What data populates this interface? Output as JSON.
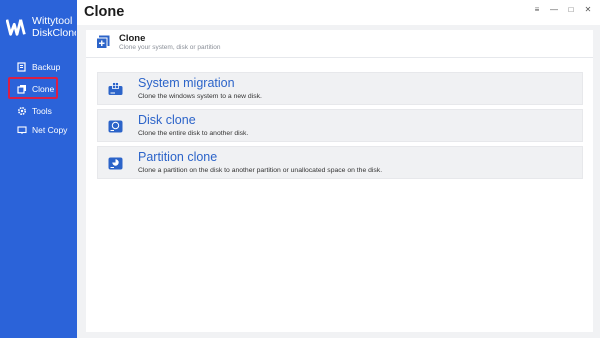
{
  "app": {
    "name_line1": "Wittytool",
    "name_line2": "DiskClone"
  },
  "sidebar": {
    "items": [
      {
        "label": "Backup",
        "icon": "backup-icon"
      },
      {
        "label": "Clone",
        "icon": "clone-icon",
        "active": true
      },
      {
        "label": "Tools",
        "icon": "gear-icon"
      },
      {
        "label": "Net Copy",
        "icon": "net-copy-icon"
      }
    ]
  },
  "titlebar": {
    "title": "Clone",
    "controls": [
      "menu-icon",
      "minimize-icon",
      "maximize-icon",
      "close-icon"
    ]
  },
  "section": {
    "title": "Clone",
    "subtitle": "Clone your system, disk or partition"
  },
  "options": [
    {
      "title": "System migration",
      "desc": "Clone the windows system to a new disk."
    },
    {
      "title": "Disk clone",
      "desc": "Clone the entire disk to another disk."
    },
    {
      "title": "Partition clone",
      "desc": "Clone a partition on the disk to another partition or unallocated space on the disk."
    }
  ],
  "colors": {
    "sidebar": "#2b63d9",
    "accent": "#2c64c9",
    "highlight": "#d91f46"
  }
}
